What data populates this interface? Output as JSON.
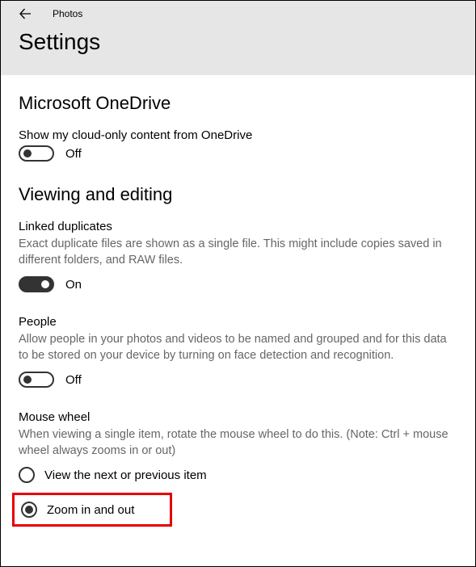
{
  "titlebar": {
    "app_name": "Photos",
    "heading": "Settings"
  },
  "onedrive": {
    "section_title": "Microsoft OneDrive",
    "cloud_label": "Show my cloud-only content from OneDrive",
    "cloud_state": "Off"
  },
  "viewing": {
    "section_title": "Viewing and editing",
    "linked_label": "Linked duplicates",
    "linked_desc": "Exact duplicate files are shown as a single file. This might include copies saved in different folders, and RAW files.",
    "linked_state": "On",
    "people_label": "People",
    "people_desc": "Allow people in your photos and videos to be named and grouped and for this data to be stored on your device by turning on face detection and recognition.",
    "people_state": "Off",
    "mouse_label": "Mouse wheel",
    "mouse_desc": "When viewing a single item, rotate the mouse wheel to do this. (Note: Ctrl + mouse wheel always zooms in or out)",
    "mouse_options": {
      "next_prev": "View the next or previous item",
      "zoom": "Zoom in and out"
    }
  }
}
